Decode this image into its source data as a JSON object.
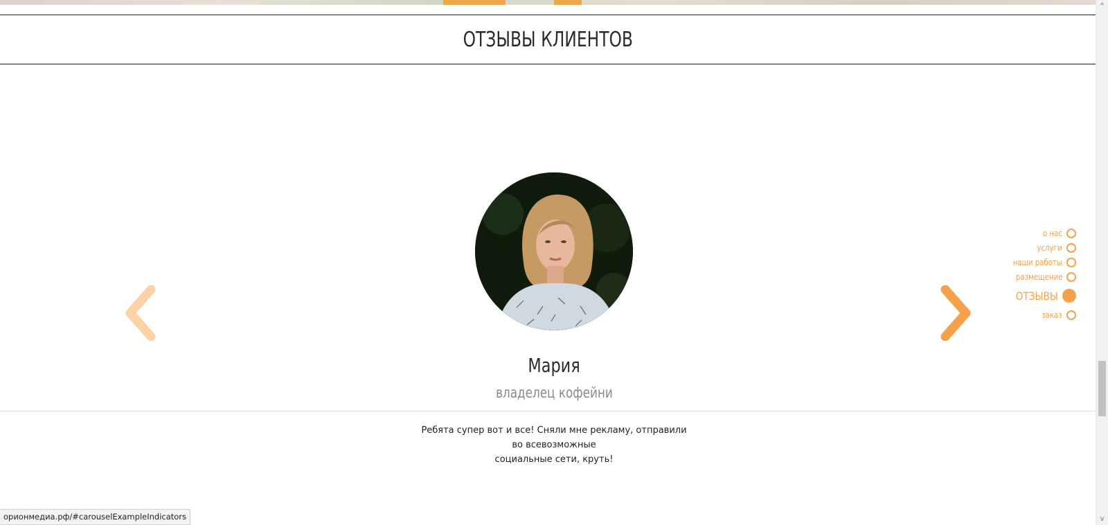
{
  "section": {
    "title": "ОТЗЫВЫ КЛИЕНТОВ"
  },
  "carousel": {
    "prev_icon": "chevron-left-icon",
    "next_icon": "chevron-right-icon",
    "colors": {
      "prev": "#fcd1a4",
      "next": "#f5a04a"
    },
    "testimonial": {
      "name": "Мария",
      "role": "владелец кофейни",
      "text_line1": "Ребята супер вот и все! Сняли мне рекламу, отправили во всевозможные",
      "text_line2": "социальные сети, круть!"
    }
  },
  "side_nav": {
    "accent": "#f5a04a",
    "items": [
      {
        "label": "о нас",
        "active": false
      },
      {
        "label": "услуги",
        "active": false
      },
      {
        "label": "наши работы",
        "active": false
      },
      {
        "label": "размещение",
        "active": false
      },
      {
        "label": "ОТЗЫВЫ",
        "active": true
      },
      {
        "label": "заказ",
        "active": false
      }
    ]
  },
  "scrollbar": {
    "up_icon": "^",
    "down_icon": "v"
  },
  "status_bar": {
    "url": "орионмедиа.рф/#carouselExampleIndicators"
  }
}
